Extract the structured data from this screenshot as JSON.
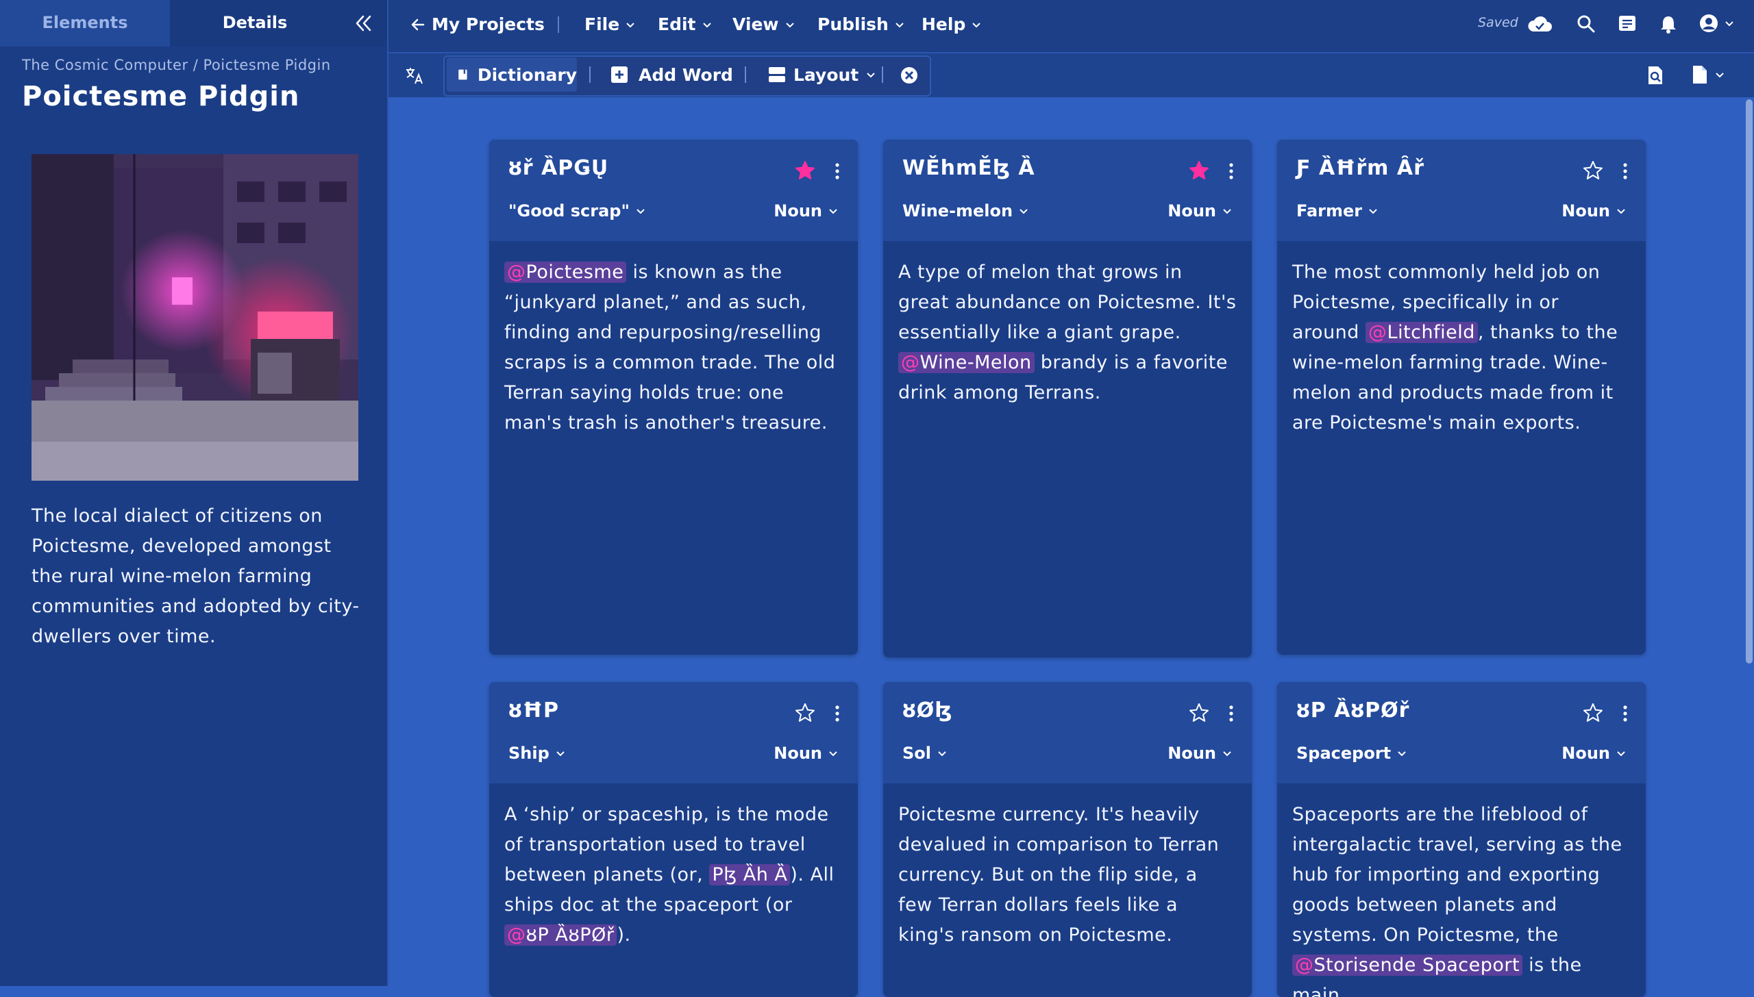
{
  "sidebar": {
    "tabs": [
      {
        "label": "Elements"
      },
      {
        "label": "Details"
      }
    ],
    "breadcrumb": "The Cosmic Computer / Poictesme Pidgin",
    "title": "Poictesme Pidgin",
    "description": "The local dialect of citizens on Poictesme, developed amongst the rural wine-melon farming communities and adopted by city-dwellers over time."
  },
  "menubar": {
    "back_label": "My Projects",
    "menus": [
      "File",
      "Edit",
      "View",
      "Publish",
      "Help"
    ],
    "saved_label": "Saved"
  },
  "toolbar": {
    "dictionary_label": "Dictionary",
    "add_word_label": "Add Word",
    "layout_label": "Layout"
  },
  "cards": [
    {
      "term": "ȣř ȀPǤŲ",
      "translation": "\"Good scrap\"",
      "pos": "Noun",
      "starred": true,
      "def_parts": [
        {
          "mention": "Poictesme"
        },
        {
          "text": " is known as the “junkyard planet,” and as such, finding and repurposing/reselling scraps is a common trade. The old Terran saying holds true: one man's trash is another's treasure."
        }
      ]
    },
    {
      "term": "WĚhmĚɮ Ȁ",
      "translation": "Wine-melon",
      "pos": "Noun",
      "starred": true,
      "def_parts": [
        {
          "text": "A type of melon that grows in great abundance on Poictesme. It's essentially like a giant grape. "
        },
        {
          "mention": "Wine-Melon"
        },
        {
          "text": " brandy is a favorite drink among Terrans."
        }
      ]
    },
    {
      "term": "Ƒ ȀĦřm Ȃř",
      "translation": "Farmer",
      "pos": "Noun",
      "starred": false,
      "def_parts": [
        {
          "text": "The most commonly held job on Poictesme, specifically in or around "
        },
        {
          "mention": "Litchfield"
        },
        {
          "text": ", thanks to the wine-melon farming trade. Wine-melon and products made from it are Poictesme's main exports."
        }
      ]
    },
    {
      "term": "ȣĦP",
      "translation": "Ship",
      "pos": "Noun",
      "starred": false,
      "def_parts": [
        {
          "text": "A ‘ship’ or spaceship, is the mode of transportation used to travel between planets (or, "
        },
        {
          "mention_plain": "Pɮ Ȁh Ȁ"
        },
        {
          "text": "). All ships doc at the spaceport (or "
        },
        {
          "mention": "ȣP ȀȣPØř"
        },
        {
          "text": ")."
        }
      ]
    },
    {
      "term": "ȣØɮ",
      "translation": "Sol",
      "pos": "Noun",
      "starred": false,
      "def_parts": [
        {
          "text": "Poictesme currency. It's heavily devalued in comparison to Terran currency. But on the flip side, a few Terran dollars feels like a king's ransom on Poictesme."
        }
      ]
    },
    {
      "term": "ȣP ȀȣPØř",
      "translation": "Spaceport",
      "pos": "Noun",
      "starred": false,
      "def_parts": [
        {
          "text": "Spaceports are the lifeblood of intergalactic travel, serving as the hub for importing and exporting goods between planets and systems. On Poictesme, the "
        },
        {
          "mention": "Storisende Spaceport"
        },
        {
          "text": " is the main"
        }
      ]
    }
  ],
  "colors": {
    "background": "#2f5fc0",
    "sidebar": "#1b3d86",
    "card": "#1b3d86",
    "card_header": "#234a9b",
    "star_active": "#ff2fa0",
    "mention_bg": "#5a3f9b",
    "mention_at": "#ff3fb0"
  },
  "icons": [
    "collapse-icon",
    "back-arrow-icon",
    "chevron-down-icon",
    "cloud-check-icon",
    "search-icon",
    "notes-icon",
    "bell-icon",
    "account-icon",
    "translate-icon",
    "book-icon",
    "plus-box-icon",
    "layout-icon",
    "close-circle-icon",
    "preview-icon",
    "file-icon",
    "star-icon",
    "kebab-icon"
  ]
}
